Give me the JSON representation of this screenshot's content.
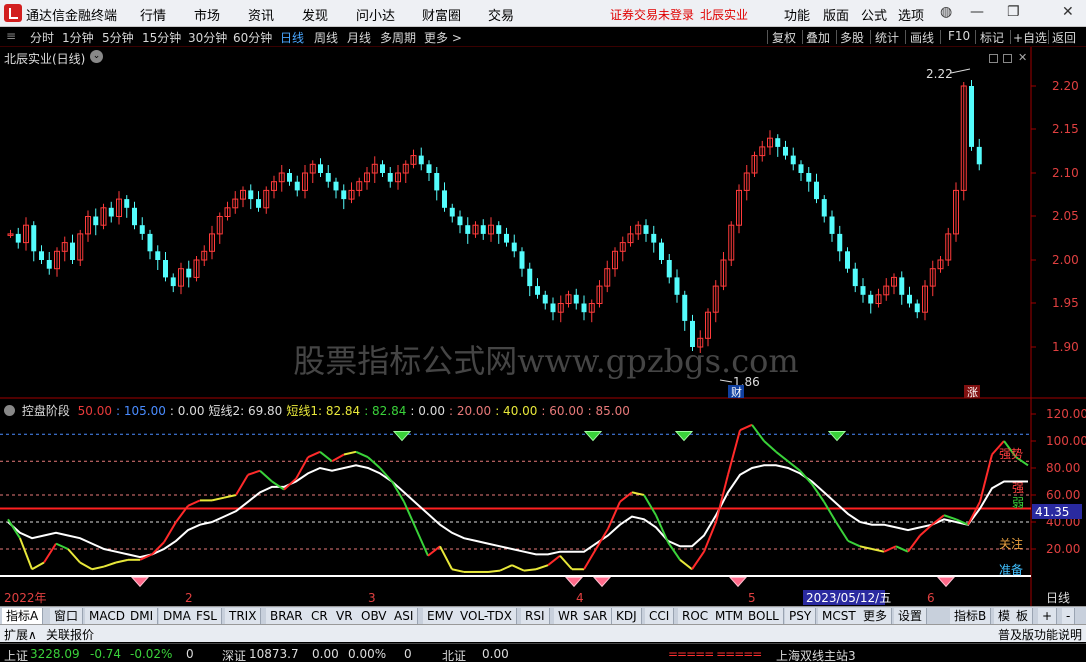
{
  "menubar": {
    "app_name": "通达信金融终端",
    "items": [
      "行情",
      "市场",
      "资讯",
      "发现",
      "问小达",
      "财富圈",
      "交易"
    ],
    "warning": "证券交易未登录",
    "stock_name": "北辰实业",
    "right_items": [
      "功能",
      "版面",
      "公式",
      "选项"
    ]
  },
  "periodbar": {
    "periods": [
      "分时",
      "1分钟",
      "5分钟",
      "15分钟",
      "30分钟",
      "60分钟",
      "日线",
      "周线",
      "月线",
      "多周期",
      "更多 >"
    ],
    "selected": "日线",
    "tools": [
      "复权",
      "叠加",
      "多股",
      "统计",
      "画线",
      "F10",
      "标记",
      "+自选",
      "返回"
    ]
  },
  "main_chart": {
    "title": "北辰实业(日线)",
    "watermark": "股票指标公式网www.gpzbgs.com",
    "high_label": "2.22",
    "low_label": "1.86",
    "cai_badge": "财",
    "zhang_badge": "涨",
    "axis_ticks": [
      "2.20",
      "2.15",
      "2.10",
      "2.05",
      "2.00",
      "1.95",
      "1.90"
    ]
  },
  "indicator": {
    "name": "控盘阶段",
    "legend": [
      {
        "text": "50.00",
        "color": "#e83a3a"
      },
      {
        "text": ": 105.00",
        "color": "#4a8cff"
      },
      {
        "text": ": 0.00",
        "color": "#dddddd"
      },
      {
        "text": "短线2: 69.80",
        "color": "#dddddd"
      },
      {
        "text": "短线1: 82.84",
        "color": "#e8e83a"
      },
      {
        "text": ": 82.84",
        "color": "#3ad23a"
      },
      {
        "text": ": 0.00",
        "color": "#dddddd"
      },
      {
        "text": ": 20.00",
        "color": "#e87a7a"
      },
      {
        "text": ": 40.00",
        "color": "#e8e83a"
      },
      {
        "text": ": 60.00",
        "color": "#e87a7a"
      },
      {
        "text": ": 85.00",
        "color": "#e87a7a"
      }
    ],
    "axis_ticks": [
      "120.00",
      "100.00",
      "80.00",
      "60.00",
      "40.00",
      "20.00"
    ],
    "current_value": "41.35",
    "labels": {
      "strong": "强势",
      "qiang": "强",
      "ruo": "弱",
      "guanzhu": "关注",
      "zhunbei": "准备"
    },
    "date_labels": [
      "2022年",
      "2",
      "3",
      "4",
      "5",
      "6"
    ],
    "date_highlight": "2023/05/12/五",
    "period_label": "日线"
  },
  "tabbar": {
    "tabs": [
      "指标A",
      "窗口",
      "MACD",
      "DMI",
      "DMA",
      "FSL",
      "TRIX",
      "BRAR",
      "CR",
      "VR",
      "OBV",
      "ASI",
      "EMV",
      "VOL-TDX",
      "RSI",
      "WR",
      "SAR",
      "KDJ",
      "CCI",
      "ROC",
      "MTM",
      "BOLL",
      "PSY",
      "MCST",
      "更多",
      "设置"
    ],
    "right": [
      "指标B",
      "模",
      "板",
      "+",
      "-"
    ]
  },
  "subbar": {
    "left": [
      "扩展∧",
      "关联报价"
    ],
    "right": "普及版功能说明"
  },
  "statusbar": {
    "sh_label": "上证",
    "sh_val": "3228.09",
    "sh_chg": "-0.74",
    "sh_pct": "-0.02%",
    "sh_vol": "0",
    "sz_label": "深证",
    "sz_val": "10873.7",
    "sz_chg": "0.00",
    "sz_pct": "0.00%",
    "sz_vol": "0",
    "bz_label": "北证",
    "bz_val": "0.00",
    "server": "上海双线主站3"
  },
  "colors": {
    "up": "#ff3b3b",
    "down": "#54fcfc",
    "axis": "#a00000",
    "accent": "#4aa7ff"
  }
}
